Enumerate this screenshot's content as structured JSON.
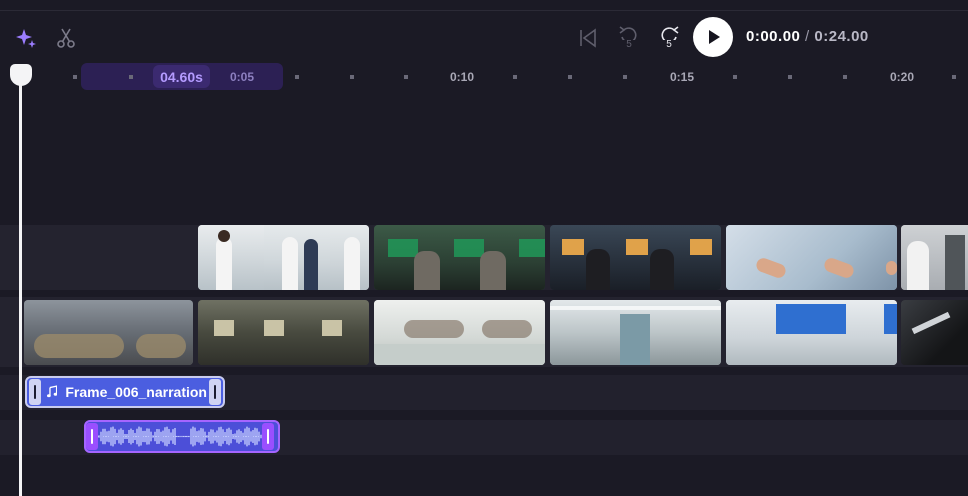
{
  "toolbar": {
    "magic_icon": "sparkles-icon",
    "cut_icon": "scissors-icon",
    "skip_start_icon": "skip-to-start-icon",
    "rewind": {
      "icon": "rewind-5-icon",
      "label": "5"
    },
    "forward": {
      "icon": "forward-5-icon",
      "label": "5"
    },
    "play_icon": "play-icon",
    "current_time": "0:00.00",
    "separator": "/",
    "total_time": "0:24.00"
  },
  "ruler": {
    "current_marker": "04.60s",
    "labels": [
      "0:05",
      "0:10",
      "0:15",
      "0:20"
    ]
  },
  "tracks": {
    "audio_clip": {
      "icon": "music-note-icon",
      "label": "Frame_006_narration"
    },
    "voice_clip": {
      "icon": "waveform-icon"
    }
  },
  "colors": {
    "background": "#1b1a25",
    "accent_purple": "#a565ff",
    "audio_blue": "#4b5ee0"
  }
}
